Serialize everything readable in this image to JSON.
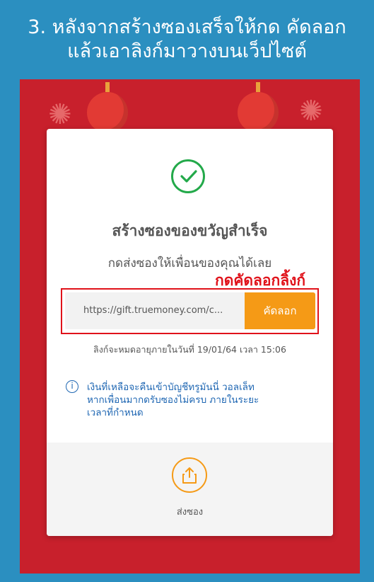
{
  "instruction": {
    "line1": "3. หลังจากสร้างซองเสร็จให้กด คัดลอก",
    "line2": "แล้วเอาลิงก์มาวางบนเว็ปไซต์"
  },
  "card": {
    "title": "สร้างซองของขวัญสำเร็จ",
    "subtitle": "กดส่งซองให้เพื่อนของคุณได้เลย",
    "annotation": "กดคัดลอกลิ้งก์",
    "link_value": "https://gift.truemoney.com/c...",
    "copy_label": "คัดลอก",
    "expiry_text": "ลิงก์จะหมดอายุภายในวันที่ 19/01/64 เวลา 15:06",
    "info_line1": "เงินที่เหลือจะคืนเข้าบัญชีทรูมันนี่ วอลเล็ท",
    "info_line2": "หากเพื่อนมากดรับซองไม่ครบ ภายในระยะ",
    "info_line3": "เวลาที่กำหนด",
    "share_label": "ส่งซอง"
  },
  "icons": {
    "check": "check-circle-icon",
    "info": "info-icon",
    "share": "share-icon"
  },
  "colors": {
    "background": "#2b8fc0",
    "phone_bg": "#c8202c",
    "accent": "#f59a16",
    "success": "#23a94a",
    "annotation": "#e0121a",
    "info": "#1f67b3"
  }
}
